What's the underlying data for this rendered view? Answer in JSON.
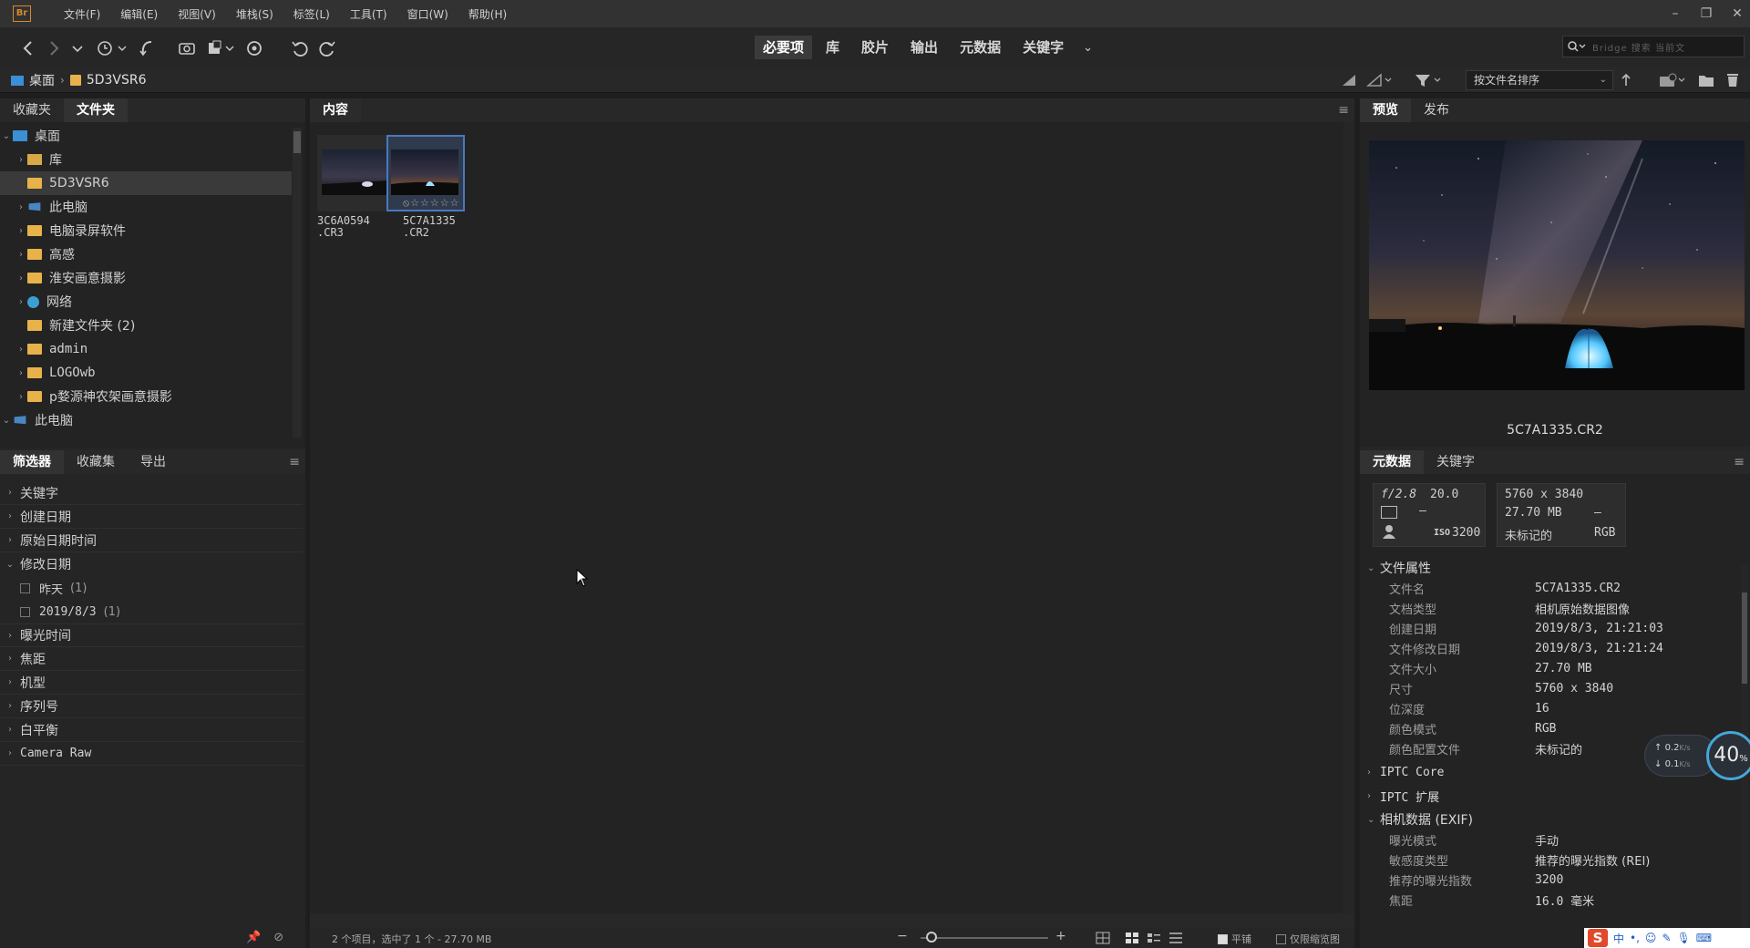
{
  "app": {
    "logo": "Br",
    "menu": [
      "文件(F)",
      "编辑(E)",
      "视图(V)",
      "堆栈(S)",
      "标签(L)",
      "工具(T)",
      "窗口(W)",
      "帮助(H)"
    ]
  },
  "toolbar": {
    "workspaces": [
      "必要项",
      "库",
      "胶片",
      "输出",
      "元数据",
      "关键字"
    ],
    "active_workspace": "必要项",
    "search_placeholder": "Bridge 搜索  当前文"
  },
  "path": {
    "crumbs": [
      "桌面",
      "5D3VSR6"
    ],
    "sort_label": "按文件名排序"
  },
  "left_top_tabs": [
    "收藏夹",
    "文件夹"
  ],
  "folder_tree": [
    {
      "label": "桌面",
      "icon": "desktop",
      "level": 0,
      "expanded": true
    },
    {
      "label": "库",
      "icon": "library",
      "level": 1
    },
    {
      "label": "5D3VSR6",
      "icon": "folder",
      "level": 1,
      "selected": true
    },
    {
      "label": "此电脑",
      "icon": "pc",
      "level": 1
    },
    {
      "label": "电脑录屏软件",
      "icon": "folder",
      "level": 1
    },
    {
      "label": "高感",
      "icon": "folder",
      "level": 1
    },
    {
      "label": "淮安画意摄影",
      "icon": "folder",
      "level": 1
    },
    {
      "label": "网络",
      "icon": "network",
      "level": 1
    },
    {
      "label": "新建文件夹 (2)",
      "icon": "folder",
      "level": 1
    },
    {
      "label": "admin",
      "icon": "folder",
      "level": 1
    },
    {
      "label": "LOGOwb",
      "icon": "folder",
      "level": 1
    },
    {
      "label": "p婺源神农架画意摄影",
      "icon": "folder",
      "level": 1
    },
    {
      "label": "此电脑",
      "icon": "pc",
      "level": 0,
      "expanded": true
    }
  ],
  "left_bottom_tabs": [
    "筛选器",
    "收藏集",
    "导出"
  ],
  "filters": {
    "keywords": "关键字",
    "created": "创建日期",
    "original_date": "原始日期时间",
    "modified": "修改日期",
    "modified_sub": [
      {
        "label": "昨天",
        "count": "(1)"
      },
      {
        "label": "2019/8/3",
        "count": "(1)"
      }
    ],
    "exposure": "曝光时间",
    "focal": "焦距",
    "model": "机型",
    "serial": "序列号",
    "white_balance": "白平衡",
    "camera_raw": "Camera Raw"
  },
  "content": {
    "tab": "内容",
    "items": [
      {
        "name1": "3C6A0594",
        "name2": ".CR3"
      },
      {
        "name1": "5C7A1335",
        "name2": ".CR2"
      }
    ],
    "rating_stars": "⦸☆☆☆☆☆",
    "status": "2 个项目，选中了 1 个 - 27.70 MB",
    "lock_thumb": "平铺",
    "preview_only": "仅限缩览图"
  },
  "preview": {
    "tabs": [
      "预览",
      "发布"
    ],
    "caption": "5C7A1335.CR2"
  },
  "metadata": {
    "tabs": [
      "元数据",
      "关键字"
    ],
    "summary": {
      "aperture": "f/2.8",
      "shutter": "20.0",
      "dash1": "—",
      "iso_label": "ISO",
      "iso": "3200",
      "dims": "5760 x 3840",
      "size": "27.70 MB",
      "dash2": "—",
      "profile": "未标记的",
      "mode": "RGB"
    },
    "file_props_title": "文件属性",
    "file_props": [
      {
        "k": "文件名",
        "v": "5C7A1335.CR2"
      },
      {
        "k": "文档类型",
        "v": "相机原始数据图像"
      },
      {
        "k": "创建日期",
        "v": "2019/8/3, 21:21:03"
      },
      {
        "k": "文件修改日期",
        "v": "2019/8/3, 21:21:24"
      },
      {
        "k": "文件大小",
        "v": "27.70 MB"
      },
      {
        "k": "尺寸",
        "v": "5760 x 3840"
      },
      {
        "k": "位深度",
        "v": "16"
      },
      {
        "k": "颜色模式",
        "v": "RGB"
      },
      {
        "k": "颜色配置文件",
        "v": "未标记的"
      }
    ],
    "iptc_core": "IPTC Core",
    "iptc_ext": "IPTC 扩展",
    "exif_title": "相机数据 (EXIF)",
    "exif": [
      {
        "k": "曝光模式",
        "v": "手动"
      },
      {
        "k": "敏感度类型",
        "v": "推荐的曝光指数 (REI)"
      },
      {
        "k": "推荐的曝光指数",
        "v": "3200"
      },
      {
        "k": "焦距",
        "v": "16.0 毫米"
      }
    ]
  },
  "overlay": {
    "up_speed": "0.2",
    "down_speed": "0.1",
    "speed_unit": "K/s",
    "percent": "40",
    "percent_unit": "%"
  },
  "ime": {
    "logo": "S",
    "lang": "中"
  },
  "colors": {
    "accent": "#4a78c0",
    "folder": "#e8b24a",
    "bridge_logo": "#d68a2b"
  }
}
